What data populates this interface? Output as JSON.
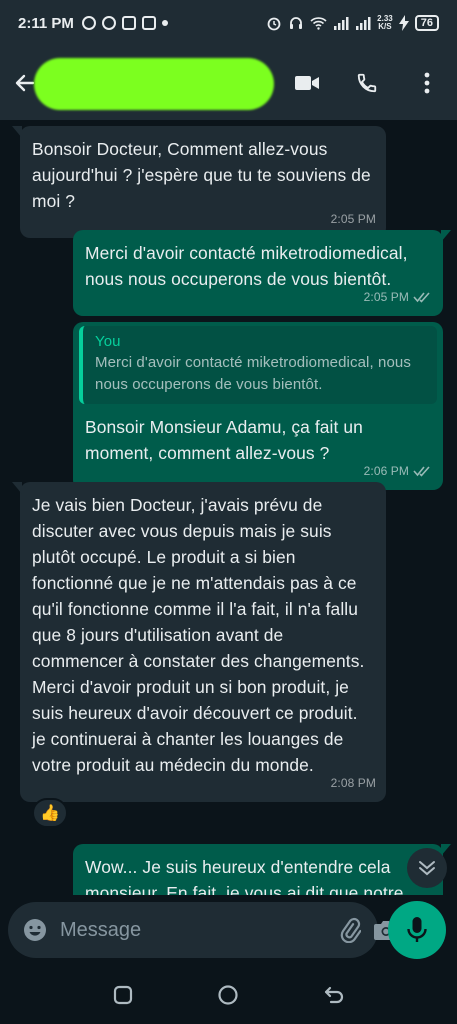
{
  "status_bar": {
    "time": "2:11 PM",
    "net_speed_value": "2.33",
    "net_speed_unit": "K/S",
    "battery": "76"
  },
  "header": {
    "contact_name": ""
  },
  "messages": [
    {
      "direction": "incoming",
      "text": "Bonsoir Docteur, Comment allez-vous aujourd'hui ? j'espère que tu te souviens de moi ?",
      "time": "2:05 PM"
    },
    {
      "direction": "outgoing",
      "text": "Merci d'avoir contacté miketrodiomedical, nous nous occuperons de vous bientôt.",
      "time": "2:05 PM"
    },
    {
      "direction": "outgoing",
      "quote_author": "You",
      "quote_text": "Merci d'avoir contacté miketrodiomedical, nous nous occuperons de vous bientôt.",
      "text": "Bonsoir Monsieur Adamu, ça fait un moment, comment allez-vous ?",
      "time": "2:06 PM"
    },
    {
      "direction": "incoming",
      "text": "Je vais bien Docteur, j'avais prévu de discuter avec vous depuis mais je suis plutôt occupé. Le produit a si bien fonctionné que je ne m'attendais pas à ce qu'il fonctionne comme il l'a fait, il n'a fallu que 8 jours d'utilisation avant de commencer à constater des changements. Merci d'avoir produit un si bon produit, je suis heureux d'avoir découvert ce produit. je continuerai à chanter les louanges de votre produit au médecin du monde.",
      "time": "2:08 PM",
      "reaction": "👍"
    },
    {
      "direction": "outgoing",
      "text": "Wow... Je suis heureux d'entendre cela monsieur. En fait, je vous ai dit que notre"
    }
  ],
  "composer": {
    "placeholder": "Message"
  },
  "colors": {
    "background": "#0b141a",
    "bubble_incoming": "#1f2c34",
    "bubble_outgoing": "#005c4b",
    "accent": "#00a884",
    "redaction": "#7cff1f"
  },
  "icons": {
    "header": [
      "back-arrow-icon",
      "video-call-icon",
      "phone-icon",
      "more-vert-icon"
    ],
    "composer": [
      "emoji-icon",
      "attach-icon",
      "camera-icon",
      "mic-icon"
    ],
    "nav": [
      "recents-icon",
      "home-icon",
      "back-icon"
    ]
  }
}
